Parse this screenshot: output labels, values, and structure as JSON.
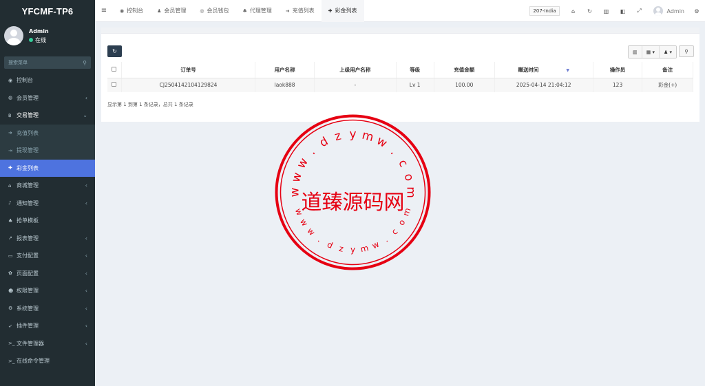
{
  "app": {
    "logo": "YFCMF-TP6"
  },
  "user": {
    "name": "Admin",
    "status": "在线"
  },
  "sidebar": {
    "search_placeholder": "搜索菜单",
    "items": [
      {
        "label": "控制台",
        "icon": "dashboard-icon",
        "glyph": "◉",
        "arrow": ""
      },
      {
        "label": "会员管理",
        "icon": "user-circle-icon",
        "glyph": "◍",
        "arrow": "‹"
      },
      {
        "label": "交易管理",
        "icon": "bitcoin-icon",
        "glyph": "฿",
        "arrow": "⌄"
      },
      {
        "label": "充值列表",
        "icon": "sign-in-icon",
        "glyph": "➜",
        "arrow": ""
      },
      {
        "label": "提现管理",
        "icon": "sign-out-icon",
        "glyph": "⇥",
        "arrow": ""
      },
      {
        "label": "彩金列表",
        "icon": "gift-icon",
        "glyph": "✚",
        "arrow": ""
      },
      {
        "label": "商城管理",
        "icon": "home-icon",
        "glyph": "⌂",
        "arrow": "‹"
      },
      {
        "label": "通知管理",
        "icon": "bell-icon",
        "glyph": "♪",
        "arrow": "‹"
      },
      {
        "label": "抢单模板",
        "icon": "sitemap-icon",
        "glyph": "♣",
        "arrow": ""
      },
      {
        "label": "报表管理",
        "icon": "line-chart-icon",
        "glyph": "↗",
        "arrow": "‹"
      },
      {
        "label": "支付配置",
        "icon": "credit-card-icon",
        "glyph": "▭",
        "arrow": "‹"
      },
      {
        "label": "页面配置",
        "icon": "cog-icon",
        "glyph": "✿",
        "arrow": "‹"
      },
      {
        "label": "权限管理",
        "icon": "users-icon",
        "glyph": "☻",
        "arrow": "‹"
      },
      {
        "label": "系统管理",
        "icon": "cogs-icon",
        "glyph": "⚙",
        "arrow": "‹"
      },
      {
        "label": "插件管理",
        "icon": "rocket-icon",
        "glyph": "➶",
        "arrow": "‹"
      },
      {
        "label": "文件管理器",
        "icon": "terminal-icon",
        "glyph": ">_",
        "arrow": "‹"
      },
      {
        "label": "在线命令管理",
        "icon": "terminal-icon",
        "glyph": ">_",
        "arrow": ""
      }
    ]
  },
  "navbar": {
    "tabs": [
      {
        "label": "控制台",
        "icon": "dashboard-icon",
        "glyph": "◉"
      },
      {
        "label": "会员管理",
        "icon": "user-icon",
        "glyph": "♟"
      },
      {
        "label": "会员钱包",
        "icon": "wallet-icon",
        "glyph": "◎"
      },
      {
        "label": "代理管理",
        "icon": "sitemap-icon",
        "glyph": "♣"
      },
      {
        "label": "充值列表",
        "icon": "sign-in-icon",
        "glyph": "➜"
      },
      {
        "label": "彩金列表",
        "icon": "gift-icon",
        "glyph": "✚"
      }
    ],
    "region": "207-India",
    "user": "Admin"
  },
  "toolbar": {
    "refresh_glyph": "↻"
  },
  "table": {
    "headers": [
      "订单号",
      "用户名称",
      "上级用户名称",
      "等级",
      "充值金额",
      "赠送时间",
      "操作员",
      "备注"
    ],
    "rows": [
      [
        "CJ2504142104129824",
        "laok888",
        "-",
        "Lv 1",
        "100.00",
        "2025-04-14 21:04:12",
        "123",
        "彩金(+)"
      ]
    ]
  },
  "summary": "显示第 1 到第 1 条记录，总共 1 条记录",
  "watermark": {
    "center_text": "道臻源码网",
    "top_arc": "www.dzymw.com",
    "bottom_arc": "www.dzymw.com",
    "color": "#e60012"
  }
}
